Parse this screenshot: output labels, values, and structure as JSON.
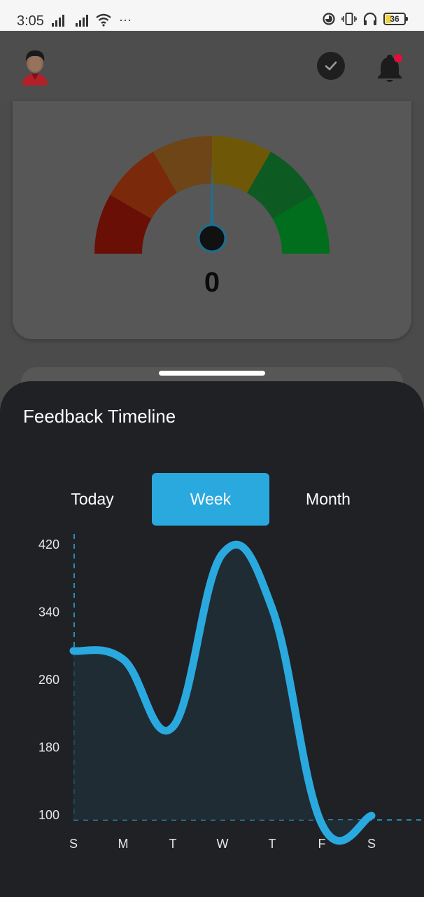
{
  "status_bar": {
    "time": "3:05",
    "more": "···",
    "battery": "36"
  },
  "app_bar": {
    "avatar_icon": "user-avatar-icon",
    "check_icon": "check-circle-icon",
    "bell_icon": "bell-icon",
    "notification_dot_color": "#e0103a"
  },
  "gauge": {
    "value": "0",
    "needle_fraction": 0.5,
    "segment_colors": [
      "#6a0f06",
      "#7a2a0a",
      "#6e4517",
      "#6e5808",
      "#0d5a22",
      "#006e1c"
    ]
  },
  "sheet": {
    "title": "Feedback Timeline",
    "tabs": [
      {
        "label": "Today",
        "active": false
      },
      {
        "label": "Week",
        "active": true
      },
      {
        "label": "Month",
        "active": false
      }
    ],
    "accent_color": "#2aa9df"
  },
  "chart_data": {
    "type": "line",
    "title": "",
    "xlabel": "",
    "ylabel": "",
    "categories": [
      "S",
      "M",
      "T",
      "W",
      "T",
      "F",
      "S"
    ],
    "ylim": [
      100,
      420
    ],
    "yticks": [
      100,
      180,
      260,
      340,
      420
    ],
    "grid": false,
    "series": [
      {
        "values": [
          300,
          290,
          210,
          415,
          350,
          95,
          105
        ]
      }
    ]
  }
}
